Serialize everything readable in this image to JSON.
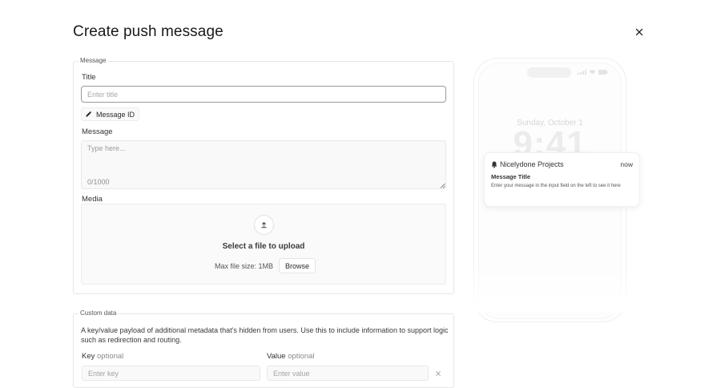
{
  "page": {
    "title": "Create push message"
  },
  "message_section": {
    "legend": "Message",
    "title_label": "Title",
    "title_placeholder": "Enter title",
    "message_id_button": "Message ID",
    "message_label": "Message",
    "message_placeholder": "Type here...",
    "char_count": "0/1000",
    "media_label": "Media",
    "upload_title": "Select a file to upload",
    "max_file_size": "Max file size: 1MB",
    "browse_button": "Browse"
  },
  "custom_data": {
    "legend": "Custom data",
    "description": "A key/value payload of additional metadata that's hidden from users. Use this to include information to support logic such as redirection and routing.",
    "key_label": "Key",
    "key_optional": "optional",
    "value_label": "Value",
    "value_optional": "optional",
    "key_placeholder": "Enter key",
    "value_placeholder": "Enter value"
  },
  "preview": {
    "date": "Sunday, October 1",
    "time": "9:41",
    "notification": {
      "app_name": "Nicelydone Projects",
      "time": "now",
      "title": "Message Title",
      "body": "Enter your message in the input field on the left to see it here"
    }
  },
  "icons": {
    "close": "close-icon",
    "pencil": "pencil-icon",
    "upload": "upload-arrow-icon",
    "bell": "bell-icon",
    "remove": "close-icon"
  }
}
